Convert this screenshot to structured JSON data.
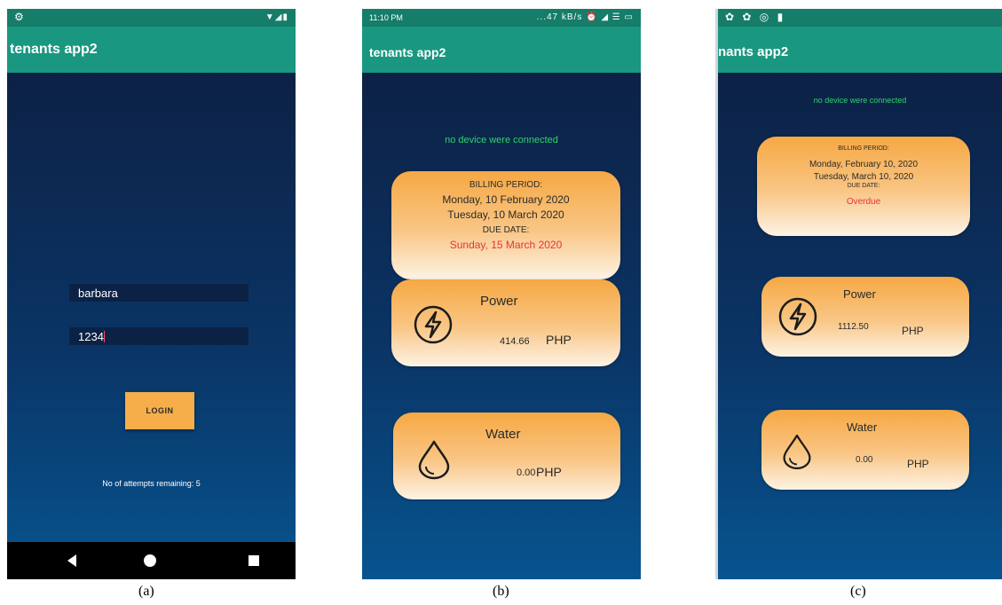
{
  "login_screen": {
    "app_title": "tenants app2",
    "username_value": "barbara",
    "password_value": "1234",
    "login_label": "LOGIN",
    "attempts_text": "No of attempts remaining: 5",
    "caption": "(a)"
  },
  "billing_screen": {
    "status_time": "11:10 PM",
    "status_icons": "...47 kB/s ⏰ ◢ ☰ ▭",
    "app_title": "tenants app2",
    "connection_text": "no device were connected",
    "billing": {
      "heading": "BILLING PERIOD:",
      "start": "Monday, 10 February 2020",
      "end": "Tuesday, 10 March 2020",
      "due_label": "DUE DATE:",
      "due_value": "Sunday, 15 March 2020"
    },
    "power": {
      "name": "Power",
      "amount": "414.66",
      "currency": "PHP",
      "icon": "bolt-icon"
    },
    "water": {
      "name": "Water",
      "amount": "0.00",
      "currency": "PHP",
      "icon": "droplet-icon"
    },
    "caption": "(b)"
  },
  "overdue_screen": {
    "status_icons": "✿ ✿ ◎ ▮",
    "app_title": "nants app2",
    "connection_text": "no device were connected",
    "billing": {
      "heading": "BILLING PERIOD:",
      "start": "Monday, February 10, 2020",
      "end": "Tuesday, March 10, 2020",
      "due_label": "DUE DATE:",
      "due_value": "Overdue"
    },
    "power": {
      "name": "Power",
      "amount": "1112.50",
      "currency": "PHP",
      "icon": "bolt-icon"
    },
    "water": {
      "name": "Water",
      "amount": "0.00",
      "currency": "PHP",
      "icon": "droplet-icon"
    },
    "caption": "(c)"
  },
  "colors": {
    "appbar": "#1a9780",
    "statusbar": "#157d69",
    "card_orange": "#f6a843",
    "connection_green": "#2fd36d",
    "due_red": "#e8333a",
    "login_button": "#f6ae4b"
  }
}
